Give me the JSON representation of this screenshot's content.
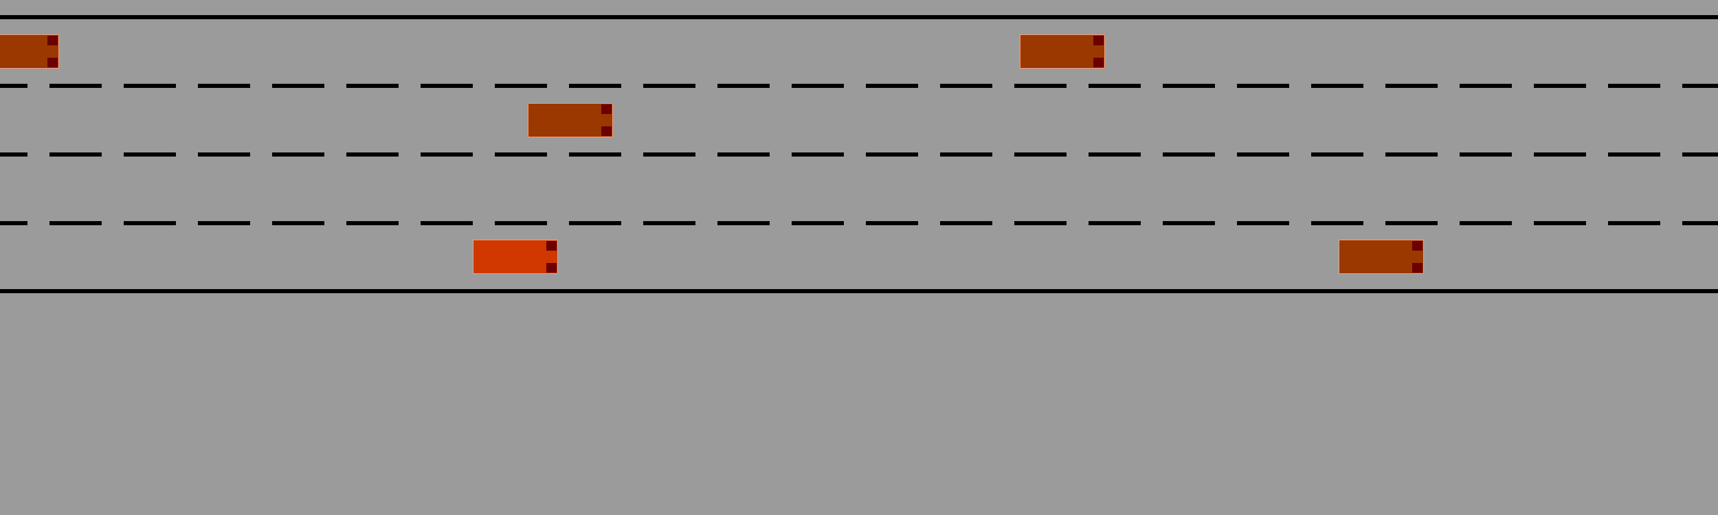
{
  "scene": {
    "background_color": "#9b9b9b",
    "road_line_color": "#000000",
    "lanes": 4,
    "lane_dividers": 3
  },
  "vehicles": [
    {
      "id": "car-1",
      "role": "other",
      "lane": 1,
      "color": "#9b3800"
    },
    {
      "id": "car-2",
      "role": "other",
      "lane": 1,
      "color": "#9b3800"
    },
    {
      "id": "car-3",
      "role": "other",
      "lane": 2,
      "color": "#9b3800"
    },
    {
      "id": "car-ego",
      "role": "ego",
      "lane": 4,
      "color": "#d03800"
    },
    {
      "id": "car-5",
      "role": "other",
      "lane": 4,
      "color": "#9b3800"
    }
  ],
  "tail_light_color": "#6b0000"
}
